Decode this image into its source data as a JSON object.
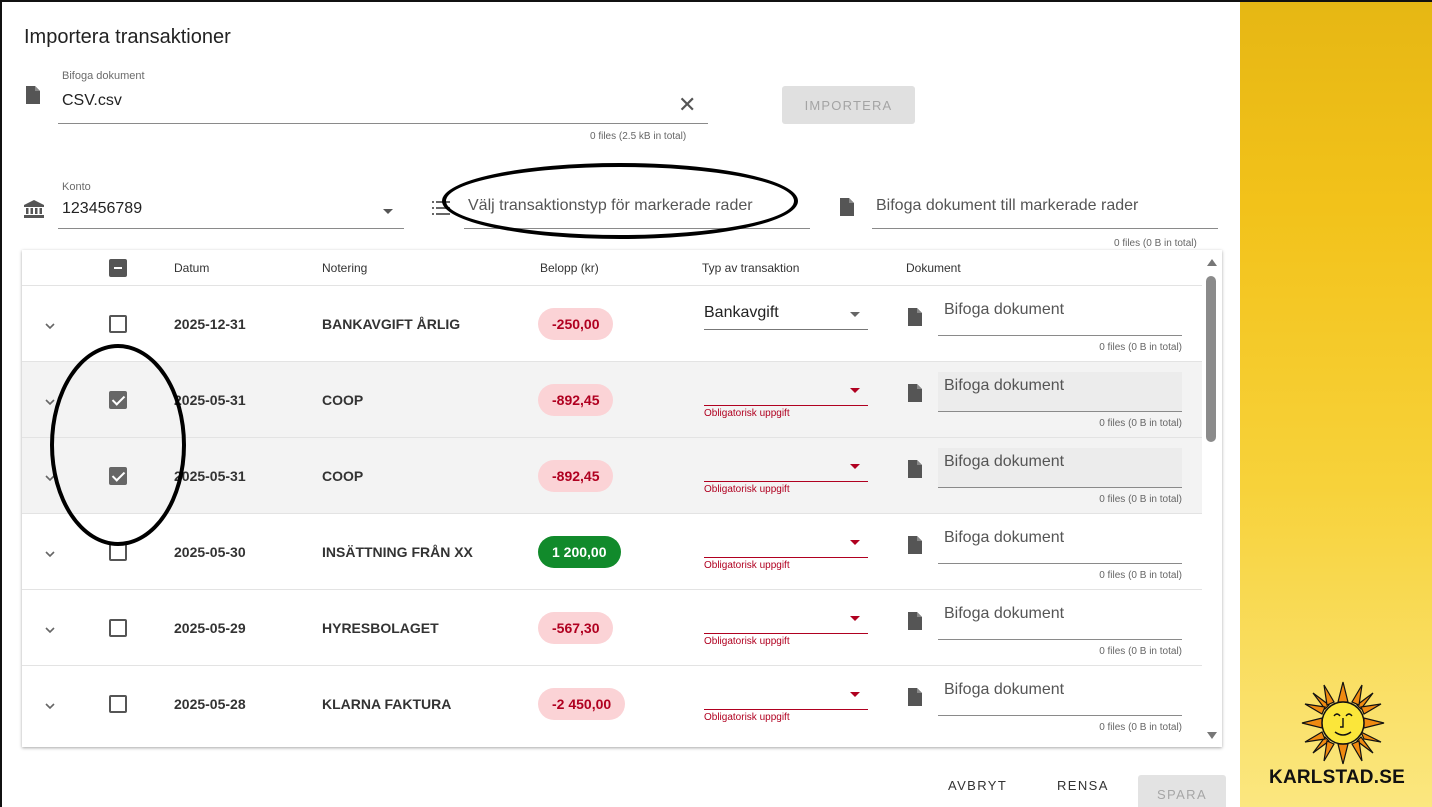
{
  "dialog": {
    "title": "Importera transaktioner",
    "attach": {
      "label": "Bifoga dokument",
      "value": "CSV.csv",
      "hint": "0 files (2.5 kB in total)",
      "import_label": "IMPORTERA"
    },
    "konto": {
      "label": "Konto",
      "value": "123456789"
    },
    "bulk_type_placeholder": "Välj transaktionstyp för markerade rader",
    "bulk_doc": {
      "placeholder": "Bifoga dokument till markerade rader",
      "hint": "0 files (0 B in total)"
    }
  },
  "table": {
    "headers": {
      "datum": "Datum",
      "notering": "Notering",
      "belopp": "Belopp (kr)",
      "typ": "Typ av transaktion",
      "dokument": "Dokument"
    },
    "rows": [
      {
        "date": "2025-12-31",
        "note": "BANKAVGIFT ÅRLIG",
        "amount": "-250,00",
        "sign": "neg",
        "checked": false,
        "type": "Bankavgift",
        "error": "",
        "doc_placeholder": "Bifoga dokument",
        "doc_hint": "0 files (0 B in total)"
      },
      {
        "date": "2025-05-31",
        "note": "COOP",
        "amount": "-892,45",
        "sign": "neg",
        "checked": true,
        "type": "",
        "error": "Obligatorisk uppgift",
        "doc_placeholder": "Bifoga dokument",
        "doc_hint": "0 files (0 B in total)"
      },
      {
        "date": "2025-05-31",
        "note": "COOP",
        "amount": "-892,45",
        "sign": "neg",
        "checked": true,
        "type": "",
        "error": "Obligatorisk uppgift",
        "doc_placeholder": "Bifoga dokument",
        "doc_hint": "0 files (0 B in total)"
      },
      {
        "date": "2025-05-30",
        "note": "INSÄTTNING FRÅN XX",
        "amount": "1 200,00",
        "sign": "pos",
        "checked": false,
        "type": "",
        "error": "Obligatorisk uppgift",
        "doc_placeholder": "Bifoga dokument",
        "doc_hint": "0 files (0 B in total)"
      },
      {
        "date": "2025-05-29",
        "note": "HYRESBOLAGET",
        "amount": "-567,30",
        "sign": "neg",
        "checked": false,
        "type": "",
        "error": "Obligatorisk uppgift",
        "doc_placeholder": "Bifoga dokument",
        "doc_hint": "0 files (0 B in total)"
      },
      {
        "date": "2025-05-28",
        "note": "KLARNA FAKTURA",
        "amount": "-2 450,00",
        "sign": "neg",
        "checked": false,
        "type": "",
        "error": "Obligatorisk uppgift",
        "doc_placeholder": "Bifoga dokument",
        "doc_hint": "0 files (0 B in total)"
      }
    ]
  },
  "actions": {
    "cancel": "AVBRYT",
    "clear": "RENSA",
    "save": "SPARA"
  },
  "brand": {
    "name": "KARLSTAD.SE"
  },
  "colors": {
    "negative_pill_bg": "#fbd3d6",
    "positive_pill_bg": "#118a2b",
    "error": "#b00020",
    "brand_yellow": "#f2c21a"
  }
}
